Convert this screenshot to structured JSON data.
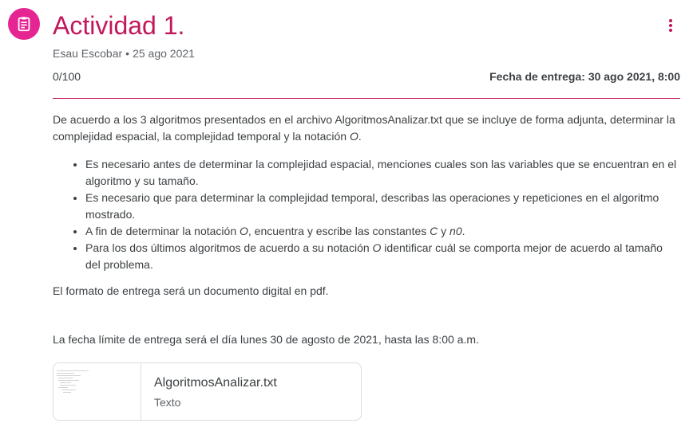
{
  "header": {
    "title": "Actividad 1.",
    "author": "Esau Escobar",
    "separator": "•",
    "date": "25 ago 2021",
    "points": "0/100",
    "due": "Fecha de entrega: 30 ago 2021, 8:00",
    "icon": "assignment-icon",
    "accent_color": "#c2185b",
    "icon_bg_color": "#e52592"
  },
  "body": {
    "intro_1": "De acuerdo a los 3 algoritmos presentados en el archivo AlgoritmosAnalizar.txt  que se incluye de forma adjunta, determinar la complejidad espacial, la complejidad temporal y la notación ",
    "intro_o": "O",
    "intro_end": ".",
    "bullets": {
      "b1": "Es necesario antes de determinar la complejidad espacial, menciones cuales son las variables que se encuentran en el algoritmo y su tamaño.",
      "b2": "Es necesario que para determinar la complejidad temporal, describas las operaciones y repeticiones en el algoritmo mostrado.",
      "b3_a": "A fin de determinar la notación ",
      "b3_o": "O",
      "b3_b": ", encuentra y escribe las constantes ",
      "b3_c": "C",
      "b3_y": " y ",
      "b3_n0": "n0",
      "b3_end": ".",
      "b4_a": "Para los dos últimos algoritmos de acuerdo a su notación ",
      "b4_o": "O",
      "b4_b": " identificar cuál se comporta mejor de acuerdo al tamaño del problema."
    },
    "formato": "El formato de entrega será un documento digital en pdf.",
    "fecha_limite": "La fecha límite de entrega será el día lunes 30 de agosto de 2021, hasta las 8:00 a.m."
  },
  "attachment": {
    "name": "AlgoritmosAnalizar.txt",
    "type": "Texto"
  }
}
